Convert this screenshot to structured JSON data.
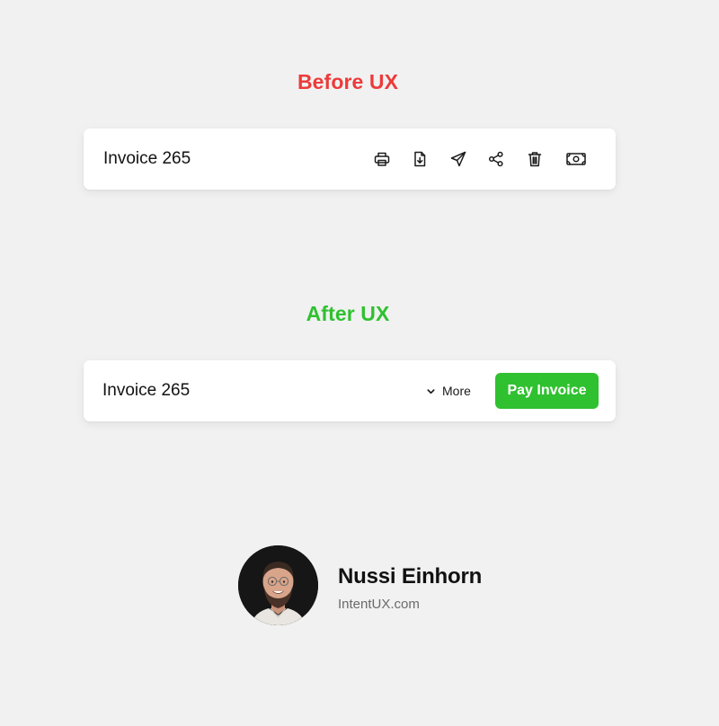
{
  "before": {
    "title": "Before UX",
    "title_color": "#ec3b3b",
    "card": {
      "invoice_title": "Invoice 265",
      "icons": [
        "printer-icon",
        "download-file-icon",
        "send-icon",
        "share-icon",
        "trash-icon",
        "money-icon"
      ]
    }
  },
  "after": {
    "title": "After UX",
    "title_color": "#2fc12f",
    "card": {
      "invoice_title": "Invoice 265",
      "more_label": "More",
      "pay_label": "Pay Invoice",
      "pay_color": "#2fc12f"
    }
  },
  "author": {
    "name": "Nussi Einhorn",
    "website": "IntentUX.com"
  }
}
